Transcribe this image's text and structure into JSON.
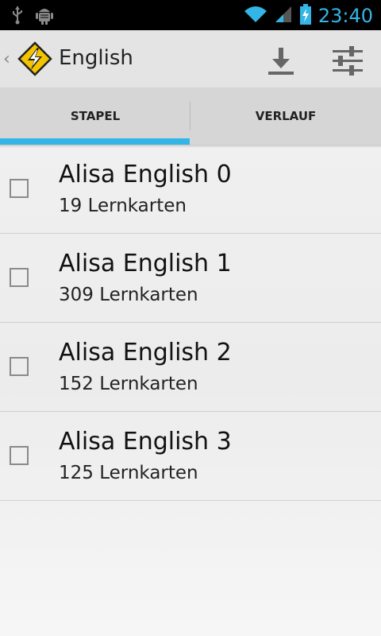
{
  "status_bar": {
    "time": "23:40",
    "icons": [
      "usb-icon",
      "android-debug-icon",
      "wifi-icon",
      "signal-icon",
      "battery-charging-icon"
    ],
    "accent_color": "#33b5e5"
  },
  "action_bar": {
    "title": "English",
    "icons": [
      "up-caret-icon",
      "lightning-warning-logo",
      "download-icon",
      "sliders-icon"
    ]
  },
  "tabs": [
    {
      "label": "STAPEL",
      "selected": true
    },
    {
      "label": "VERLAUF",
      "selected": false
    }
  ],
  "decks": [
    {
      "title": "Alisa English 0",
      "count": "19 Lernkarten",
      "checked": false
    },
    {
      "title": "Alisa English 1",
      "count": "309 Lernkarten",
      "checked": false
    },
    {
      "title": "Alisa English 2",
      "count": "152 Lernkarten",
      "checked": false
    },
    {
      "title": "Alisa English 3",
      "count": "125 Lernkarten",
      "checked": false
    }
  ]
}
